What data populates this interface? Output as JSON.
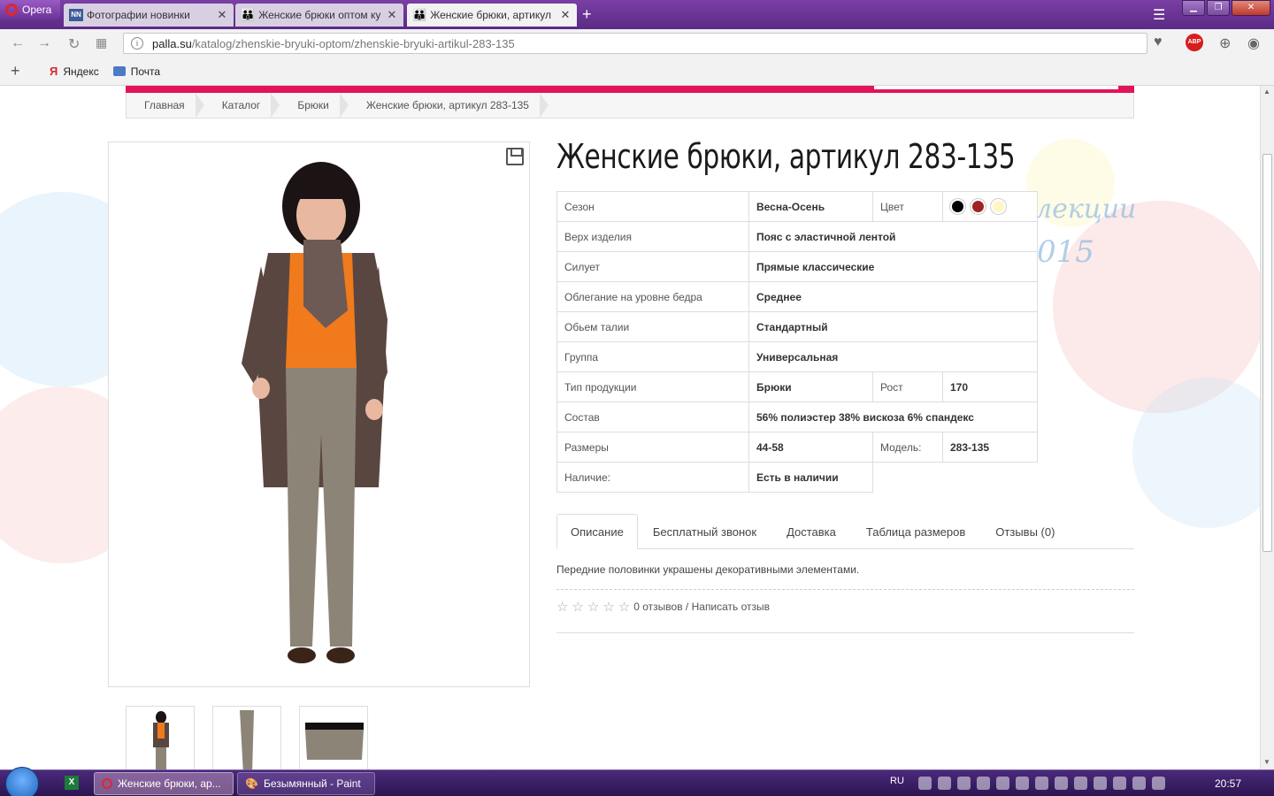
{
  "browser": {
    "name": "Opera",
    "tabs": [
      {
        "label": "Фотографии новинки"
      },
      {
        "label": "Женские брюки оптом ку"
      },
      {
        "label": "Женские брюки, артикул"
      }
    ],
    "url_domain": "palla.su",
    "url_path": "/katalog/zhenskie-bryuki-optom/zhenskie-bryuki-artikul-283-135",
    "adblock_label": "ABP",
    "bookmarks": [
      {
        "label": "Яндекс"
      },
      {
        "label": "Почта"
      }
    ]
  },
  "breadcrumb": [
    "Главная",
    "Каталог",
    "Брюки",
    "Женские брюки, артикул 283-135"
  ],
  "product": {
    "title": "Женские брюки, артикул 283-135",
    "props": {
      "season_label": "Сезон",
      "season_value": "Весна-Осень",
      "color_label": "Цвет",
      "colors": [
        "#000000",
        "#9e2424",
        "#fdf7c6"
      ],
      "top_label": "Верх изделия",
      "top_value": "Пояс с эластичной лентой",
      "silhouette_label": "Силует",
      "silhouette_value": "Прямые классические",
      "fit_label": "Облегание на уровне бедра",
      "fit_value": "Среднее",
      "waist_label": "Обьем талии",
      "waist_value": "Стандартный",
      "group_label": "Группа",
      "group_value": "Универсальная",
      "type_label": "Тип продукции",
      "type_value": "Брюки",
      "height_label": "Рост",
      "height_value": "170",
      "composition_label": "Состав",
      "composition_value": "56% полиэстер 38% вискоза 6% спандекс",
      "sizes_label": "Размеры",
      "sizes_value": "44-58",
      "model_label": "Модель:",
      "model_value": "283-135",
      "stock_label": "Наличие:",
      "stock_value": "Есть в наличии"
    },
    "tabs": [
      "Описание",
      "Бесплатный звонок",
      "Доставка",
      "Таблица размеров",
      "Отзывы (0)"
    ],
    "description": "Передние половинки украшены декоративными элементами.",
    "reviews_text": "0 отзывов / Написать отзыв",
    "rating": 0
  },
  "watermark": {
    "line1": "лекции",
    "line2": "015"
  },
  "taskbar": {
    "apps": [
      {
        "label": "Женские брюки, ар..."
      },
      {
        "label": "Безымянный - Paint"
      }
    ],
    "lang": "RU",
    "time": "20:57"
  }
}
